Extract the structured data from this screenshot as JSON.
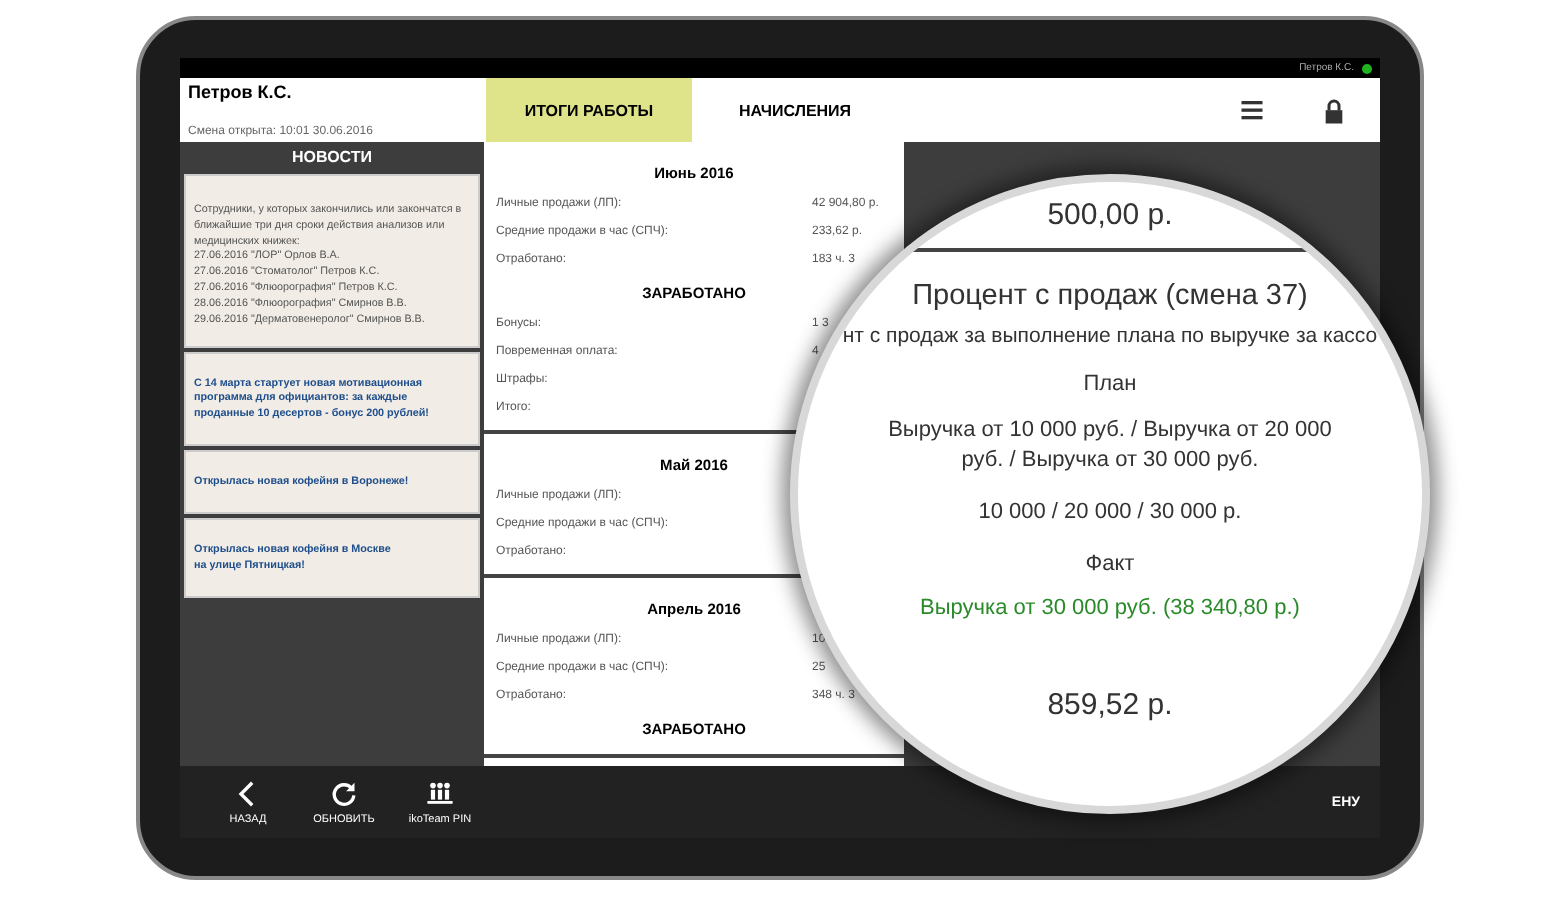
{
  "status_bar": {
    "user": "Петров К.С.",
    "online": true
  },
  "header": {
    "name": "Петров К.С.",
    "shift": "Смена открыта: 10:01 30.06.2016"
  },
  "tabs": [
    {
      "label": "ИТОГИ РАБОТЫ",
      "selected": true
    },
    {
      "label": "НАЧИСЛЕНИЯ",
      "selected": false
    }
  ],
  "news": {
    "title": "НОВОСТИ",
    "items": [
      {
        "kind": "plain",
        "text": "Сотрудники, у которых закончились или закончатся в ближайшие три дня сроки действия анализов или медицинских книжек:\n27.06.2016 \"ЛОР\" Орлов В.А.\n27.06.2016 \"Стоматолог\" Петров К.С.\n27.06.2016 \"Флюорография\" Петров К.С.\n28.06.2016 \"Флюорография\" Смирнов В.В.\n29.06.2016 \"Дерматовенеролог\" Смирнов В.В."
      },
      {
        "kind": "link",
        "text": "С 14 марта стартует новая мотивационная программа для официантов: за каждые проданные 10 десертов - бонус 200 рублей!"
      },
      {
        "kind": "link",
        "text": "Открылась новая кофейня в Воронеже!"
      },
      {
        "kind": "link",
        "text": "Открылась новая кофейня в Москве\nна улице Пятницкая!"
      }
    ]
  },
  "months": [
    {
      "title": "Июнь 2016",
      "rows": [
        {
          "label": "Личные продажи (ЛП):",
          "value": "42 904,80 р."
        },
        {
          "label": "Средние продажи в час (СПЧ):",
          "value": "233,62 р."
        },
        {
          "label": "Отработано:",
          "value": "183 ч. 3"
        }
      ],
      "earned": {
        "title": "ЗАРАБОТАНО",
        "rows": [
          {
            "label": "Бонусы:",
            "value": "1 3"
          },
          {
            "label": "Повременная оплата:",
            "value": "4"
          },
          {
            "label": "Штрафы:"
          },
          {
            "label": "Итого:"
          }
        ]
      }
    },
    {
      "title": "Май 2016",
      "rows": [
        {
          "label": "Личные продажи (ЛП):"
        },
        {
          "label": "Средние продажи в час (СПЧ):"
        },
        {
          "label": "Отработано:"
        }
      ]
    },
    {
      "title": "Апрель 2016",
      "rows": [
        {
          "label": "Личные продажи (ЛП):",
          "value": "10"
        },
        {
          "label": "Средние продажи в час (СПЧ):",
          "value": "25"
        },
        {
          "label": "Отработано:",
          "value": "348 ч. 3"
        }
      ],
      "earned": {
        "title": "ЗАРАБОТАНО"
      }
    }
  ],
  "magnifier": {
    "top_amount": "500,00 р.",
    "title": "Процент с продаж (смена 37)",
    "description": "нт с продаж за выполнение плана по выручке за кассо",
    "plan_heading": "План",
    "plan_text": "Выручка от 10 000 руб. / Выручка от 20 000 руб. / Выручка от 30 000 руб.",
    "plan_values": "10 000 / 20 000 / 30 000 р.",
    "fact_heading": "Факт",
    "fact_text": "Выручка от 30 000 руб. (38 340,80 р.)",
    "bottom_amount": "859,52 р."
  },
  "toolbar": {
    "buttons": [
      {
        "kind": "back",
        "label": "НАЗАД"
      },
      {
        "kind": "refresh",
        "label": "ОБНОВИТЬ"
      },
      {
        "kind": "team",
        "label": "ikoTeam PIN"
      }
    ],
    "right_label": "ЕНУ"
  }
}
